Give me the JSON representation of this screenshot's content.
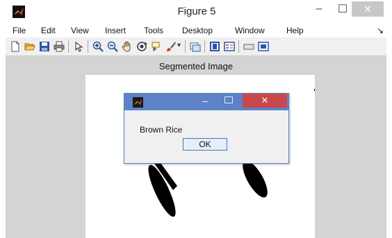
{
  "window": {
    "title": "Figure 5",
    "minimize_glyph": "–",
    "maximize_glyph": "☐",
    "close_glyph": "✕"
  },
  "menu": {
    "items": [
      "File",
      "Edit",
      "View",
      "Insert",
      "Tools",
      "Desktop",
      "Window",
      "Help"
    ],
    "overflow_glyph": "↘"
  },
  "toolbar": {
    "icons": [
      "new-figure-icon",
      "open-file-icon",
      "save-figure-icon",
      "print-figure-icon",
      "edit-plot-icon",
      "zoom-in-icon",
      "zoom-out-icon",
      "pan-icon",
      "rotate-3d-icon",
      "data-cursor-icon",
      "brush-icon",
      "link-plot-icon",
      "colorbar-icon",
      "legend-icon",
      "hide-plot-tools-icon",
      "show-plot-tools-icon"
    ]
  },
  "axes": {
    "title": "Segmented Image"
  },
  "dialog": {
    "minimize_glyph": "–",
    "close_glyph": "✕",
    "message": "Brown Rice",
    "ok_label": "OK"
  },
  "colors": {
    "dialog_titlebar": "#5d82c8",
    "dialog_close": "#c9484a",
    "figure_background": "#d4d4d4",
    "matlab_icon": "#e0491f"
  }
}
